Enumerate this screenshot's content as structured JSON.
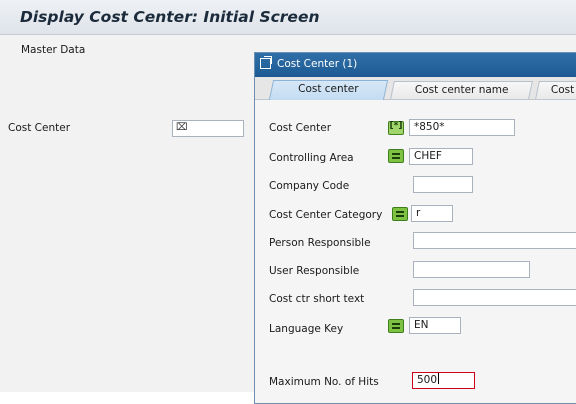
{
  "app": {
    "title": "Display Cost Center: Initial Screen"
  },
  "menu": {
    "items": [
      "Master Data"
    ]
  },
  "main": {
    "cost_center_label": "Cost Center"
  },
  "dialog": {
    "title": "Cost Center (1)",
    "tabs": [
      {
        "label": "Cost center",
        "active": true
      },
      {
        "label": "Cost center name",
        "active": false
      },
      {
        "label": "Cost c",
        "active": false
      }
    ],
    "fields": {
      "cost_center": {
        "label": "Cost Center",
        "value": "*850*",
        "option": "pattern"
      },
      "controlling_area": {
        "label": "Controlling Area",
        "value": "CHEF",
        "option": "equal"
      },
      "company_code": {
        "label": "Company Code",
        "value": ""
      },
      "cost_center_category": {
        "label": "Cost Center Category",
        "value": "r",
        "option": "equal"
      },
      "person_responsible": {
        "label": "Person Responsible",
        "value": ""
      },
      "user_responsible": {
        "label": "User Responsible",
        "value": ""
      },
      "cost_ctr_short_text": {
        "label": "Cost ctr short text",
        "value": ""
      },
      "language_key": {
        "label": "Language Key",
        "value": "EN",
        "option": "equal"
      },
      "max_hits": {
        "label": "Maximum No. of Hits",
        "value": "500"
      }
    }
  },
  "colors": {
    "dialog_header": "#1d5a93",
    "active_tab": "#c3dcf2",
    "option_button": "#7dc242",
    "focus_border": "#d0021b"
  }
}
